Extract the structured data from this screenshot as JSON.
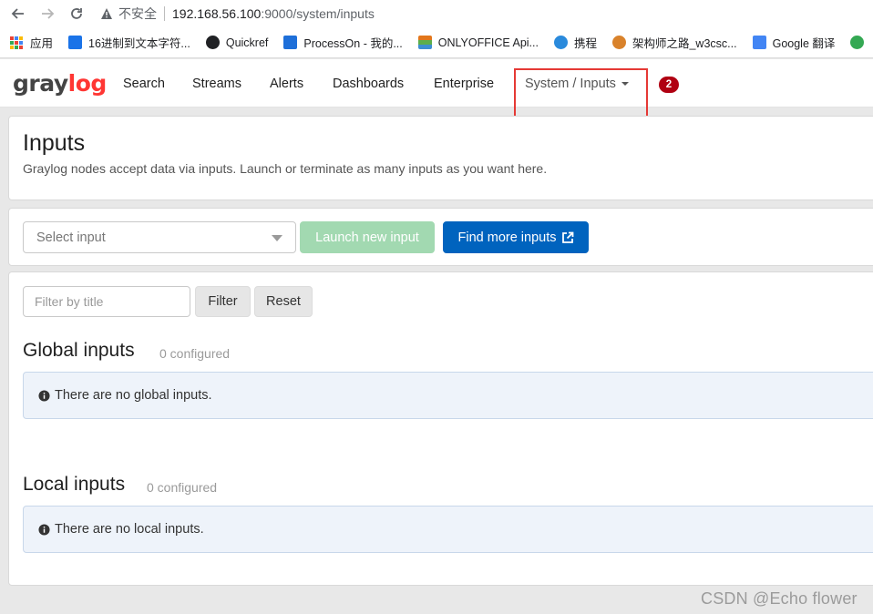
{
  "browser": {
    "insecure_label": "不安全",
    "url_host": "192.168.56.100",
    "url_rest": ":9000/system/inputs",
    "bookmarks": [
      {
        "label": "应用",
        "color": "#5f6368"
      },
      {
        "label": "16进制到文本字符...",
        "color": "#1a73e8"
      },
      {
        "label": "Quickref",
        "color": "#202124"
      },
      {
        "label": "ProcessOn - 我的...",
        "color": "#1e6fd9"
      },
      {
        "label": "ONLYOFFICE Api...",
        "color": "#e2761b"
      },
      {
        "label": "携程",
        "color": "#2a8adc"
      },
      {
        "label": "架构师之路_w3csc...",
        "color": "#d9822b"
      },
      {
        "label": "Google 翻译",
        "color": "#4285f4"
      }
    ]
  },
  "graylog": {
    "logo_gray": "gray",
    "logo_log": "log",
    "nav": {
      "search": "Search",
      "streams": "Streams",
      "alerts": "Alerts",
      "dashboards": "Dashboards",
      "enterprise": "Enterprise",
      "system": "System / Inputs"
    },
    "notification_count": "2"
  },
  "header": {
    "title": "Inputs",
    "description": "Graylog nodes accept data via inputs. Launch or terminate as many inputs as you want here."
  },
  "launch": {
    "select_placeholder": "Select input",
    "launch_button": "Launch new input",
    "find_button": "Find more inputs"
  },
  "list": {
    "filter_placeholder": "Filter by title",
    "filter_button": "Filter",
    "reset_button": "Reset",
    "global_title": "Global inputs",
    "global_count": "0 configured",
    "global_empty": "There are no global inputs.",
    "local_title": "Local inputs",
    "local_count": "0 configured",
    "local_empty": "There are no local inputs."
  },
  "watermark": "CSDN @Echo flower",
  "colors": {
    "accent_red": "#ff3633",
    "primary_blue": "#0063be",
    "success_light": "#a2d9b1",
    "badge_red": "#b00012",
    "highlight_box": "#e53935"
  }
}
